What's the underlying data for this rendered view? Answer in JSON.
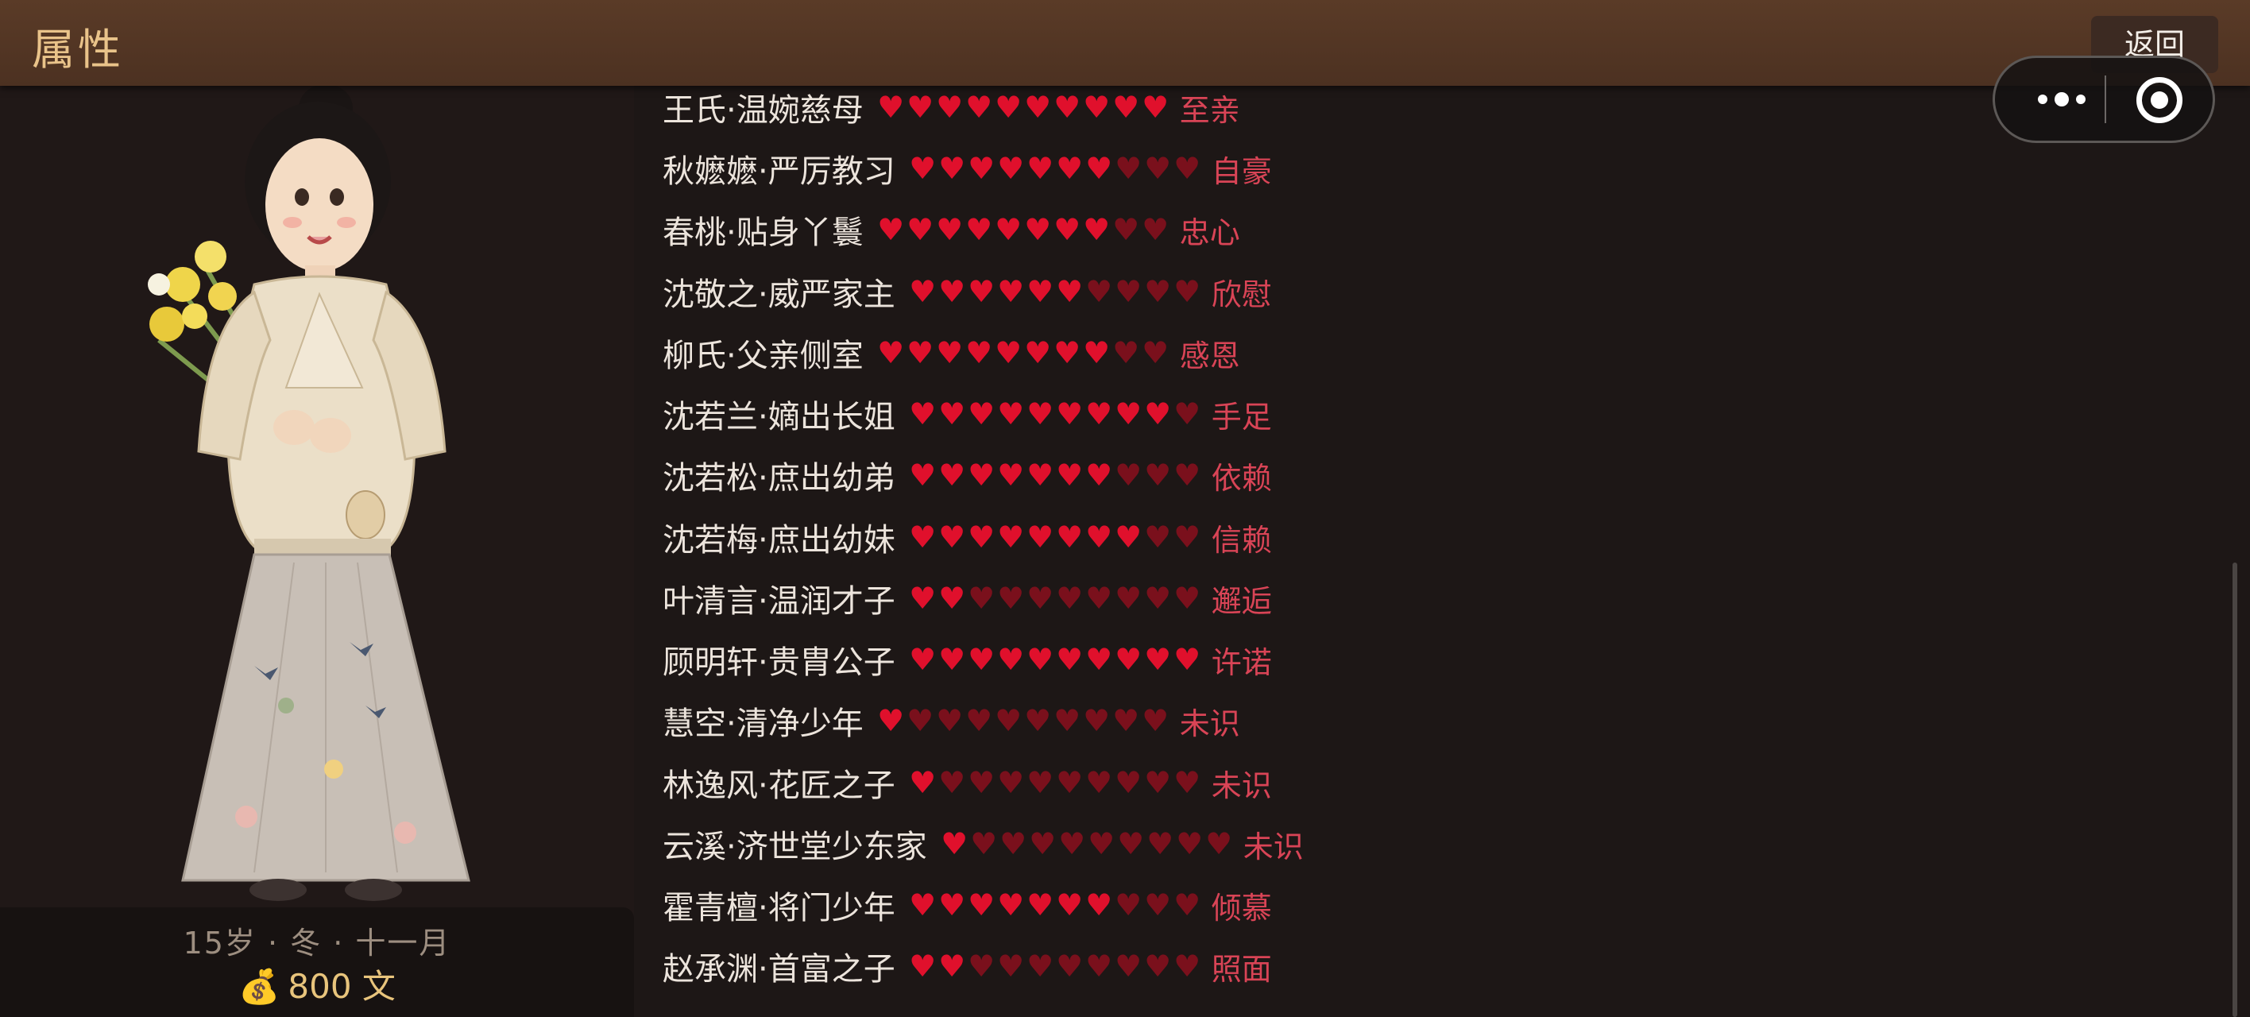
{
  "header": {
    "title": "属性",
    "back_label": "返回"
  },
  "player": {
    "age_season": "15岁 · 冬 · 十一月",
    "money_icon": "money-bag-icon",
    "money": "800 文"
  },
  "colors": {
    "heart_on": "#e0102c",
    "heart_off": "#7a101c",
    "status": "#d94456",
    "title": "#e9c38a"
  },
  "relations": [
    {
      "name": "王氏·温婉慈母",
      "hearts": 10,
      "max": 10,
      "status": "至亲"
    },
    {
      "name": "秋嬷嬷·严厉教习",
      "hearts": 7,
      "max": 10,
      "status": "自豪"
    },
    {
      "name": "春桃·贴身丫鬟",
      "hearts": 8,
      "max": 10,
      "status": "忠心"
    },
    {
      "name": "沈敬之·威严家主",
      "hearts": 6,
      "max": 10,
      "status": "欣慰"
    },
    {
      "name": "柳氏·父亲侧室",
      "hearts": 8,
      "max": 10,
      "status": "感恩"
    },
    {
      "name": "沈若兰·嫡出长姐",
      "hearts": 9,
      "max": 10,
      "status": "手足"
    },
    {
      "name": "沈若松·庶出幼弟",
      "hearts": 7,
      "max": 10,
      "status": "依赖"
    },
    {
      "name": "沈若梅·庶出幼妹",
      "hearts": 8,
      "max": 10,
      "status": "信赖"
    },
    {
      "name": "叶清言·温润才子",
      "hearts": 2,
      "max": 10,
      "status": "邂逅"
    },
    {
      "name": "顾明轩·贵胄公子",
      "hearts": 10,
      "max": 10,
      "status": "许诺"
    },
    {
      "name": "慧空·清净少年",
      "hearts": 1,
      "max": 10,
      "status": "未识"
    },
    {
      "name": "林逸风·花匠之子",
      "hearts": 1,
      "max": 10,
      "status": "未识"
    },
    {
      "name": "云溪·济世堂少东家",
      "hearts": 1,
      "max": 10,
      "status": "未识"
    },
    {
      "name": "霍青檀·将门少年",
      "hearts": 7,
      "max": 10,
      "status": "倾慕"
    },
    {
      "name": "赵承渊·首富之子",
      "hearts": 2,
      "max": 10,
      "status": "照面"
    }
  ]
}
